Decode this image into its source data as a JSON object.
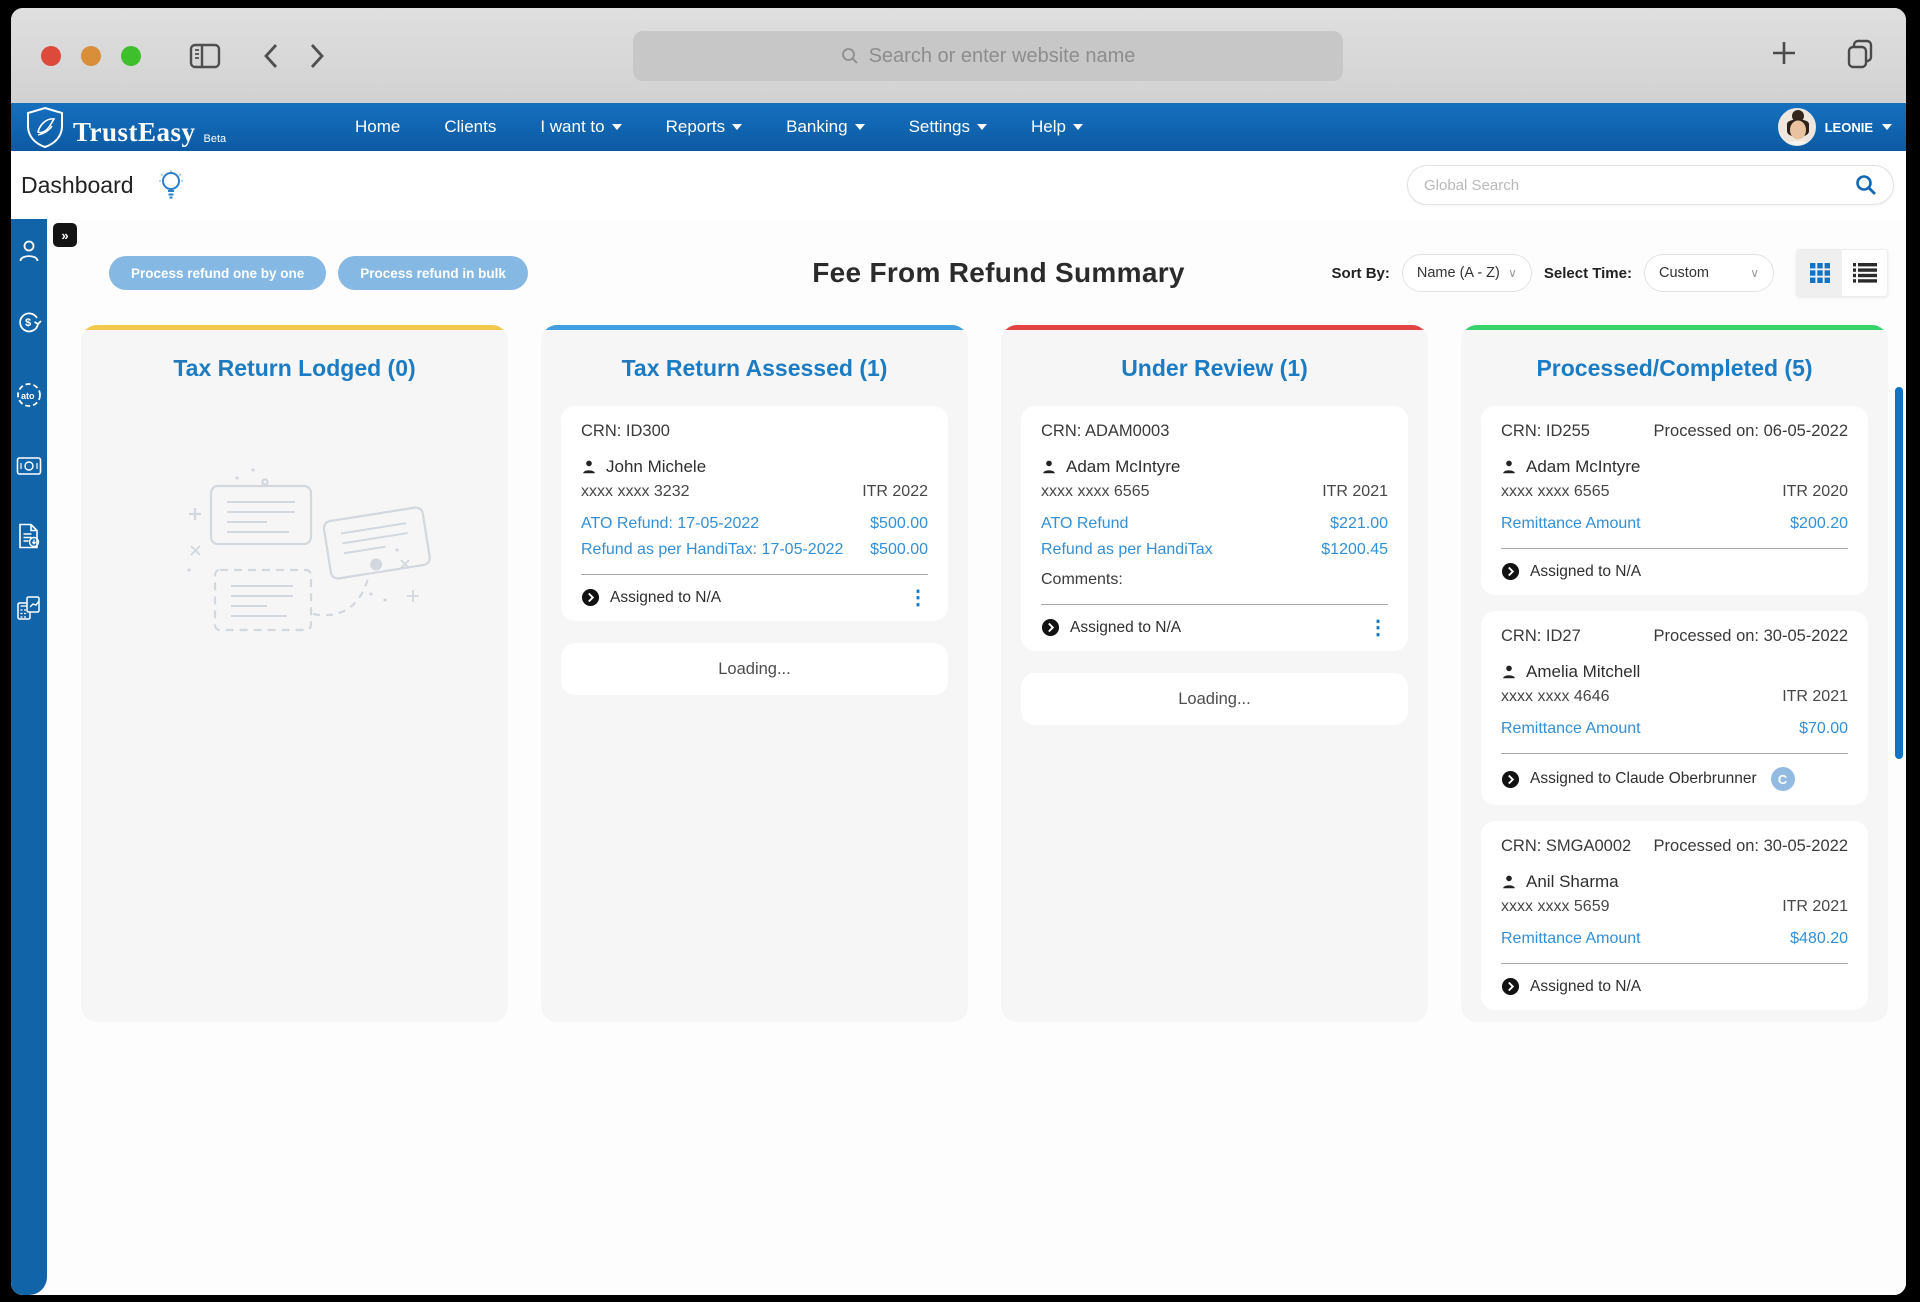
{
  "browser": {
    "url_placeholder": "Search or enter website name"
  },
  "nav": {
    "brand": "TrustEasy",
    "brand_suffix": "Beta",
    "items": [
      {
        "label": "Home",
        "caret": false
      },
      {
        "label": "Clients",
        "caret": false
      },
      {
        "label": "I want to",
        "caret": true
      },
      {
        "label": "Reports",
        "caret": true
      },
      {
        "label": "Banking",
        "caret": true
      },
      {
        "label": "Settings",
        "caret": true
      },
      {
        "label": "Help",
        "caret": true
      }
    ],
    "user": "LEONIE"
  },
  "subheader": {
    "title": "Dashboard",
    "global_search_placeholder": "Global Search"
  },
  "sidebar": {
    "expand_glyph": "»",
    "icons": [
      "clients-icon",
      "refund-cycle-icon",
      "ato-icon",
      "payments-icon",
      "report-download-icon",
      "tax-calculator-icon"
    ]
  },
  "toolbar": {
    "buttons": [
      {
        "label": "Process refund one by one"
      },
      {
        "label": "Process refund in bulk"
      }
    ],
    "title": "Fee From Refund Summary",
    "sort_by_label": "Sort By:",
    "sort_by_value": "Name (A - Z)",
    "select_time_label": "Select Time:",
    "select_time_value": "Custom"
  },
  "colors": {
    "nav_blue": "#0d5aa3",
    "sidebar_blue": "#1264a8",
    "header_blue": "#1b7cc4",
    "link_blue": "#338fd6",
    "col_lodged_accent": "#F2C94C",
    "col_assessed_accent": "#3F9FE0",
    "col_review_accent": "#E24444",
    "col_processed_accent": "#35D36A",
    "scrollbar_blue": "#1173c5"
  },
  "board": {
    "columns": [
      {
        "header": "Tax Return Lodged (0)",
        "cards": []
      },
      {
        "header": "Tax Return Assessed (1)",
        "loading": "Loading...",
        "cards": [
          {
            "crn": "CRN: ID300",
            "name": "John Michele",
            "masked": "xxxx xxxx 3232",
            "itr": "ITR 2022",
            "rows": [
              {
                "label": "ATO Refund: 17-05-2022",
                "amount": "$500.00"
              },
              {
                "label": "Refund as per HandiTax: 17-05-2022",
                "amount": "$500.00"
              }
            ],
            "assigned": "Assigned to N/A"
          }
        ]
      },
      {
        "header": "Under Review (1)",
        "loading": "Loading...",
        "cards": [
          {
            "crn": "CRN: ADAM0003",
            "name": "Adam McIntyre",
            "masked": "xxxx xxxx 6565",
            "itr": "ITR 2021",
            "rows": [
              {
                "label": "ATO Refund",
                "amount": "$221.00"
              },
              {
                "label": "Refund as per HandiTax",
                "amount": "$1200.45"
              }
            ],
            "comments_label": "Comments:",
            "assigned": "Assigned to N/A"
          }
        ]
      },
      {
        "header": "Processed/Completed (5)",
        "cards": [
          {
            "crn": "CRN: ID255",
            "processed_on": "Processed on: 06-05-2022",
            "name": "Adam McIntyre",
            "masked": "xxxx xxxx 6565",
            "itr": "ITR 2020",
            "rows": [
              {
                "label": "Remittance Amount",
                "amount": "$200.20"
              }
            ],
            "assigned": "Assigned to N/A"
          },
          {
            "crn": "CRN: ID27",
            "processed_on": "Processed on: 30-05-2022",
            "name": "Amelia Mitchell",
            "masked": "xxxx xxxx 4646",
            "itr": "ITR 2021",
            "rows": [
              {
                "label": "Remittance Amount",
                "amount": "$70.00"
              }
            ],
            "assigned": "Assigned to Claude Oberbrunner",
            "assignee_badge": "C"
          },
          {
            "crn": "CRN: SMGA0002",
            "processed_on": "Processed on: 30-05-2022",
            "name": "Anil Sharma",
            "masked": "xxxx xxxx 5659",
            "itr": "ITR 2021",
            "rows": [
              {
                "label": "Remittance Amount",
                "amount": "$480.20"
              }
            ],
            "assigned": "Assigned to N/A"
          }
        ]
      }
    ]
  }
}
